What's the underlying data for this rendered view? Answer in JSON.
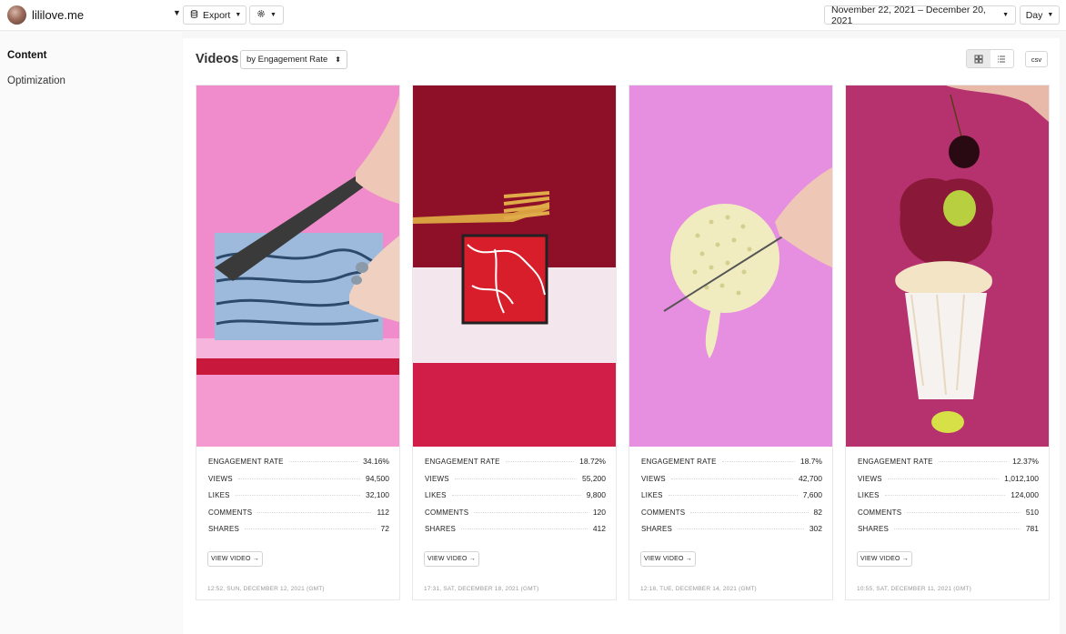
{
  "header": {
    "account_name": "lililove.me",
    "export_label": "Export",
    "date_range": "November 22, 2021 – December 20, 2021",
    "granularity": "Day"
  },
  "sidebar": {
    "items": [
      {
        "label": "Content",
        "active": true
      },
      {
        "label": "Optimization",
        "active": false
      }
    ]
  },
  "main": {
    "title": "Videos",
    "sort_label": "by Engagement Rate",
    "csv_label": "csv"
  },
  "metric_labels": {
    "engagement": "ENGAGEMENT RATE",
    "views": "VIEWS",
    "likes": "LIKES",
    "comments": "COMMENTS",
    "shares": "SHARES"
  },
  "view_video_label": "VIEW VIDEO →",
  "videos": [
    {
      "engagement": "34.16%",
      "views": "94,500",
      "likes": "32,100",
      "comments": "112",
      "shares": "72",
      "timestamp": "12:52, SUN, DECEMBER 12, 2021 (GMT)"
    },
    {
      "engagement": "18.72%",
      "views": "55,200",
      "likes": "9,800",
      "comments": "120",
      "shares": "412",
      "timestamp": "17:31, SAT, DECEMBER 18, 2021 (GMT)"
    },
    {
      "engagement": "18.7%",
      "views": "42,700",
      "likes": "7,600",
      "comments": "82",
      "shares": "302",
      "timestamp": "12:18, TUE, DECEMBER 14, 2021 (GMT)"
    },
    {
      "engagement": "12.37%",
      "views": "1,012,100",
      "likes": "124,000",
      "comments": "510",
      "shares": "781",
      "timestamp": "10:55, SAT, DECEMBER 11, 2021 (GMT)"
    }
  ],
  "colors": {
    "thumb1_bg": "#f08ccb",
    "thumb2_bg": "#c8163e",
    "thumb3_bg": "#e68ee0",
    "thumb4_bg": "#b5326f"
  }
}
